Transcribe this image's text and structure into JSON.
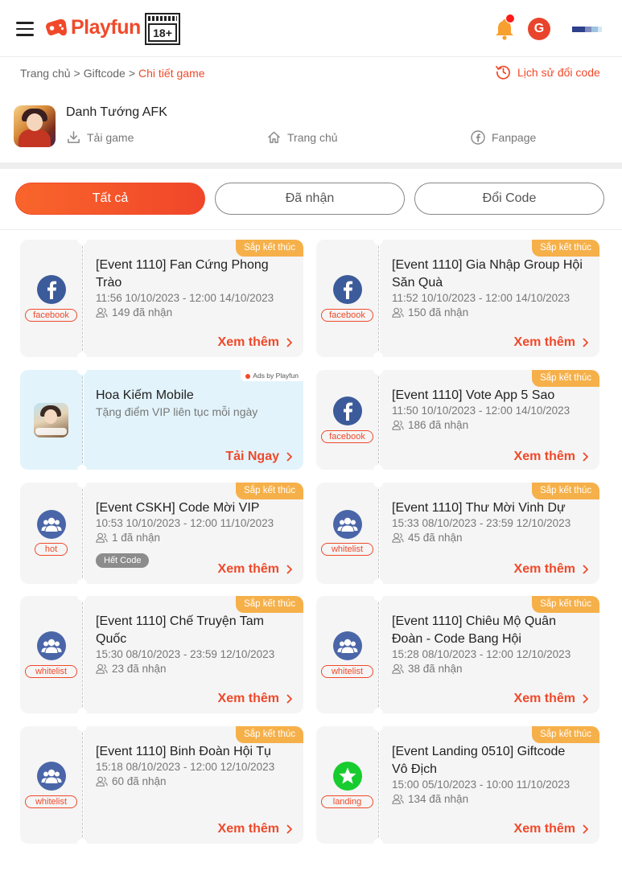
{
  "header": {
    "logo_text": "Playfun",
    "age_rating": "18+",
    "avatar_letter": "G",
    "user_bar_colors": [
      "#2e3f8c",
      "#7f8bbf",
      "#9cc3e0",
      "#d6e6f3"
    ]
  },
  "breadcrumb": {
    "items": [
      "Trang chủ",
      "Giftcode",
      "Chi tiết game"
    ],
    "separator": ">",
    "history_label": "Lịch sử đổi code"
  },
  "game": {
    "name": "Danh Tướng AFK",
    "links": {
      "download": "Tải game",
      "home": "Trang chủ",
      "fanpage": "Fanpage"
    }
  },
  "tabs": [
    {
      "label": "Tất cả",
      "active": true
    },
    {
      "label": "Đã nhận",
      "active": false
    },
    {
      "label": "Đổi Code",
      "active": false
    }
  ],
  "ending_label": "Sắp kết thúc",
  "more_label": "Xem thêm",
  "cards": [
    {
      "source": "facebook",
      "icon": "facebook-icon",
      "title": "[Event 1110] Fan Cứng Phong Trào",
      "time": "11:56 10/10/2023 - 12:00 14/10/2023",
      "received": "149 đã nhận"
    },
    {
      "source": "facebook",
      "icon": "facebook-icon",
      "title": "[Event 1110] Gia Nhập Group Hội Săn Quà",
      "time": "11:52 10/10/2023 - 12:00 14/10/2023",
      "received": "150 đã nhận"
    },
    {
      "source": "facebook",
      "icon": "facebook-icon",
      "title": "[Event 1110] Vote App 5 Sao",
      "time": "11:50 10/10/2023 - 12:00 14/10/2023",
      "received": "186 đã nhận"
    },
    {
      "source": "hot",
      "icon": "group-icon",
      "title": "[Event CSKH] Code Mời VIP",
      "time": "10:53 10/10/2023 - 12:00 11/10/2023",
      "received": "1 đã nhận",
      "status": "Hết Code"
    },
    {
      "source": "whitelist",
      "icon": "group-icon",
      "title": "[Event 1110] Thư Mời Vinh Dự",
      "time": "15:33 08/10/2023 - 23:59 12/10/2023",
      "received": "45 đã nhận"
    },
    {
      "source": "whitelist",
      "icon": "group-icon",
      "title": "[Event 1110] Chế Truyện Tam Quốc",
      "time": "15:30 08/10/2023 - 23:59 12/10/2023",
      "received": "23 đã nhận"
    },
    {
      "source": "whitelist",
      "icon": "group-icon",
      "title": "[Event 1110] Chiêu Mộ Quân Đoàn - Code Bang Hội",
      "time": "15:28 08/10/2023 - 12:00 12/10/2023",
      "received": "38 đã nhận"
    },
    {
      "source": "whitelist",
      "icon": "group-icon",
      "title": "[Event 1110] Binh Đoàn Hội Tụ",
      "time": "15:18 08/10/2023 - 12:00 12/10/2023",
      "received": "60 đã nhận"
    },
    {
      "source": "landing",
      "icon": "star-icon",
      "title": "[Event Landing 0510] Giftcode Vô Địch",
      "time": "15:00 05/10/2023 - 10:00 11/10/2023",
      "received": "134 đã nhận"
    }
  ],
  "ad": {
    "badge": "Ads by Playfun",
    "title": "Hoa Kiếm Mobile",
    "subtitle": "Tặng điểm VIP liên tục mỗi ngày",
    "cta": "Tải Ngay"
  },
  "colors": {
    "brand": "#f0492a",
    "ending_badge": "#f6b04a",
    "card_bg": "#f5f5f5",
    "ad_bg": "#e2f3fb",
    "facebook": "#3c5b9a",
    "landing": "#18cc2f"
  }
}
